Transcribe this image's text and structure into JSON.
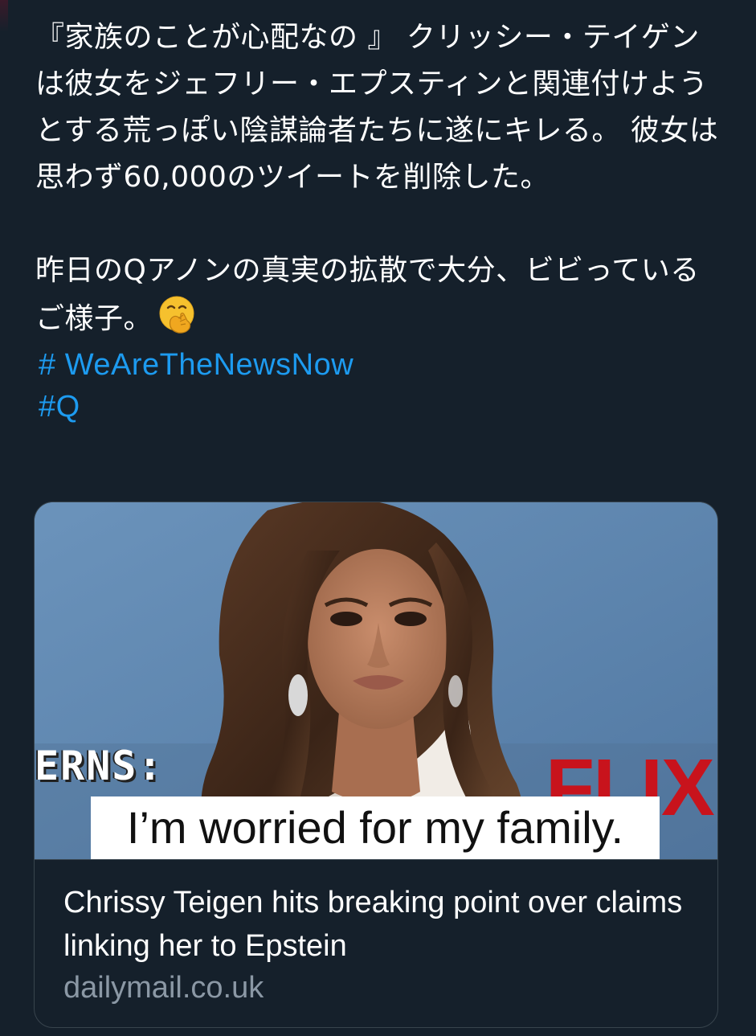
{
  "tweet": {
    "paragraph_1": "『家族のことが心配なの 』 クリッシー・テイゲンは彼女をジェフリー・エプスティンと関連付けようとする荒っぽい陰謀論者たちに遂にキレる。 彼女は思わず60,000のツイートを削除した。",
    "paragraph_2": "昨日のQアノンの真実の拡散で大分、ビビっているご様子。",
    "emoji": "face-with-hand-over-mouth",
    "hashtags": [
      "# WeAreTheNewsNow",
      "#Q"
    ]
  },
  "link_card": {
    "image_caption": "I’m worried for my family.",
    "image_overlay_left": "ERNS:",
    "image_overlay_right": "FLIX",
    "title": "Chrissy Teigen hits breaking point over claims linking her to Epstein",
    "domain": "dailymail.co.uk"
  },
  "colors": {
    "background": "#15202b",
    "text": "#ffffff",
    "link": "#1d9bf0",
    "muted": "#8b98a5",
    "border": "#38444d"
  }
}
